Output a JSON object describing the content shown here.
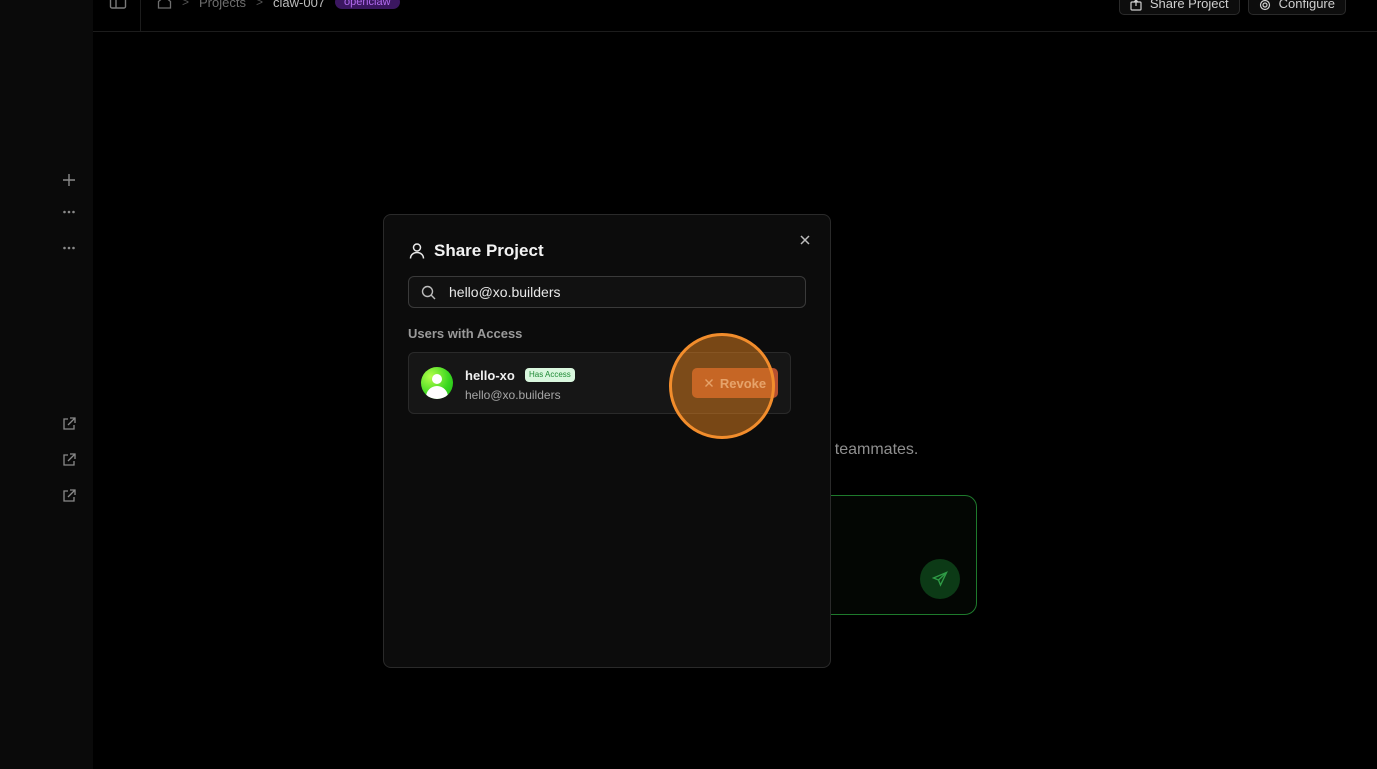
{
  "header": {
    "breadcrumbs": {
      "projects": "Projects",
      "current": "claw-007",
      "badge": "openclaw"
    },
    "share_label": "Share Project",
    "configure_label": "Configure"
  },
  "background": {
    "hint_text": "r teammates."
  },
  "modal": {
    "title": "Share Project",
    "search": {
      "value": "hello@xo.builders",
      "placeholder": ""
    },
    "section_label": "Users with Access",
    "users": [
      {
        "name": "hello-xo",
        "badge": "Has Access",
        "email": "hello@xo.builders",
        "action_label": "Revoke"
      }
    ]
  },
  "colors": {
    "accent_green": "#1e7a2c",
    "revoke": "#b8502f",
    "badge_purple": "#3b1760",
    "highlight": "#f28d2c"
  },
  "icons": {
    "rail": [
      "plus-icon",
      "more-horizontal-icon",
      "more-horizontal-icon",
      "external-link-icon",
      "external-link-icon",
      "external-link-icon"
    ],
    "modal_title": "user-icon",
    "search": "search-icon",
    "close": "close-icon",
    "send": "send-icon"
  }
}
